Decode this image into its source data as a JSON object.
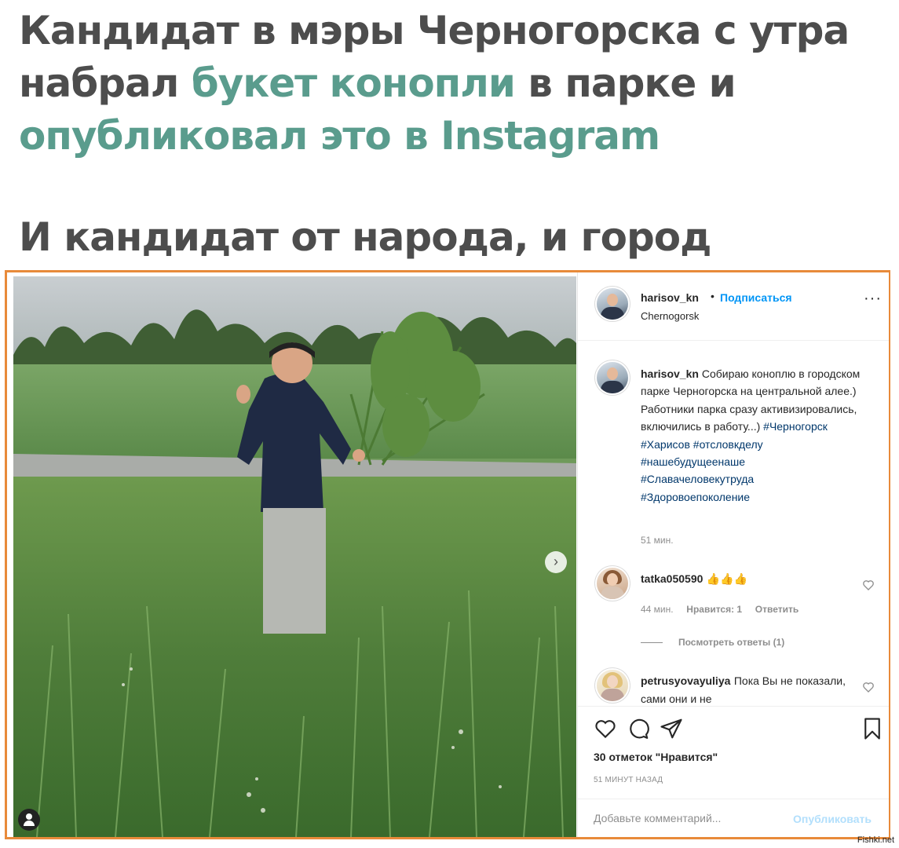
{
  "headline": {
    "part1": "Кандидат в мэры Черногорска с утра набрал ",
    "accent1": "букет конопли",
    "part2": " в парке и ",
    "accent2": "опубликовал это в Instagram",
    "accent_color": "#5a9c8d",
    "text_color": "#4d4d4d"
  },
  "subheadline": "И кандидат от народа, и город хороший",
  "frame_color": "#e88a3a",
  "post": {
    "username": "harisov_kn",
    "separator": "•",
    "follow_label": "Подписаться",
    "location": "Chernogorsk",
    "more_icon": "more-options-icon",
    "caption": {
      "username": "harisov_kn",
      "text": "Собираю коноплю в городском парке Черногорска на центральной алее.) Работники парка сразу активизировались, включились в работу...)",
      "hashtags": [
        "#Черногорск",
        "#Харисов",
        "#отсловкделу",
        "#нашебудущеенаше",
        "#Славачеловекутруда",
        "#Здоровоепоколение"
      ],
      "time": "51 мин."
    },
    "comments": [
      {
        "username": "tatka050590",
        "text": "👍👍👍",
        "time": "44 мин.",
        "likes": "Нравится: 1",
        "reply": "Ответить",
        "view_replies": "Посмотреть ответы (1)"
      },
      {
        "username": "petrusyovayuliya",
        "text": "Пока Вы не показали, сами они и не"
      }
    ],
    "likes_count": "30 отметок \"Нравится\"",
    "posted_ago": "51 МИНУТ НАЗАД",
    "add_comment_placeholder": "Добавьте комментарий...",
    "publish_label": "Опубликовать",
    "link_color": "#0095f6"
  },
  "watermark": "Fishki.net"
}
